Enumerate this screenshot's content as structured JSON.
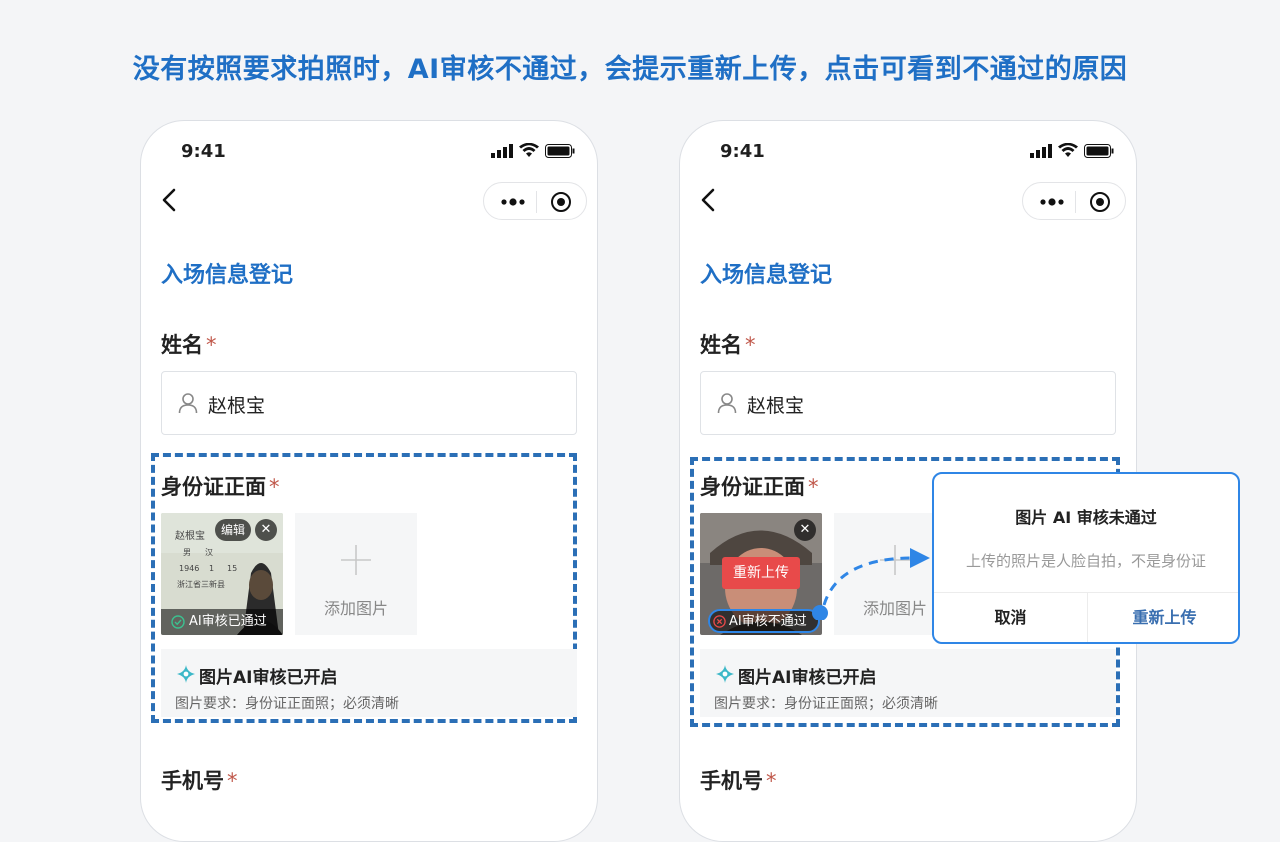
{
  "headline": "没有按照要求拍照时，AI审核不通过，会提示重新上传，点击可看到不通过的原因",
  "status_time": "9:41",
  "page_title": "入场信息登记",
  "name_label": "姓名",
  "required_mark": "*",
  "name_value": "赵根宝",
  "id_front_label": "身份证正面",
  "phone_label": "手机号",
  "left": {
    "edit_label": "编辑",
    "close_label": "✕",
    "ai_passed_label": "AI审核已通过",
    "id_card_text": {
      "name": "赵根宝",
      "sex": "男",
      "ethnicity": "汉",
      "year": "1946",
      "month": "1",
      "day": "15",
      "address": "浙江省三新县"
    }
  },
  "right": {
    "reupload_tag": "重新上传",
    "ai_failed_label": "AI审核不通过",
    "close_label": "✕"
  },
  "add_image_label": "添加图片",
  "ai_enabled_title": "图片AI审核已开启",
  "ai_requirement": "图片要求：身份证正面照；必须清晰",
  "dialog": {
    "title": "图片 AI 审核未通过",
    "message": "上传的照片是人脸自拍，不是身份证",
    "cancel": "取消",
    "retry": "重新上传"
  },
  "colors": {
    "accent": "#1f6fc5",
    "dashed_border": "#2b6fb6",
    "highlight_blue": "#2f86e6",
    "error_red": "#e84a4a",
    "pass_green": "#3cc08f"
  }
}
